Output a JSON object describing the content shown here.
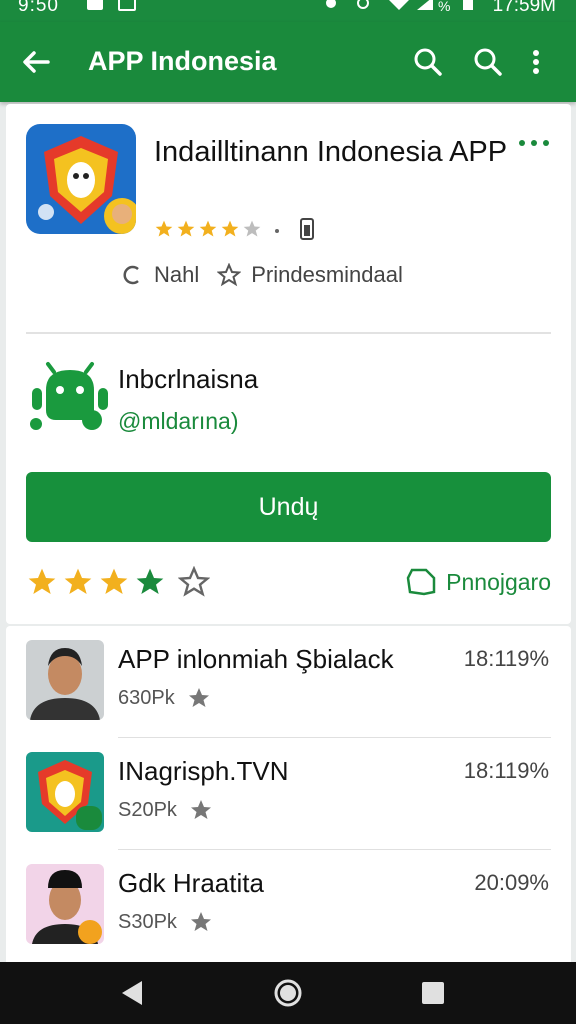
{
  "status_bar": {
    "time": "9:50",
    "clock": "17:59M",
    "battery": "%"
  },
  "app_bar": {
    "back_icon": "arrow-left-icon",
    "title": "APP Indonesia",
    "search_icons": [
      "search-icon",
      "search-icon"
    ],
    "menu_icon": "overflow-menu-icon"
  },
  "app": {
    "title": "Indailltinann Indonesia APP",
    "rating_stars": 4,
    "tag_a": "Nahl",
    "tag_b": "Prindesmindaal"
  },
  "developer": {
    "name": "Inbcrlnaisna",
    "handle": "@mldarına)"
  },
  "install_label": "Undų",
  "rating_big": {
    "filled": 4,
    "total": 5
  },
  "project_label": "Pnnojgaro",
  "related": [
    {
      "title": "APP inlonmiah Şbialack",
      "sub": "630Pk",
      "pct": "18:119%"
    },
    {
      "title": "INagrisph.TVN",
      "sub": "S20Pk",
      "pct": "18:119%"
    },
    {
      "title": "Gdk Hraatita",
      "sub": "S30Pk",
      "pct": "20:09%"
    }
  ],
  "colors": {
    "primary": "#1a8a3c",
    "star": "#f2b01e",
    "star_green": "#1a8a3c"
  }
}
